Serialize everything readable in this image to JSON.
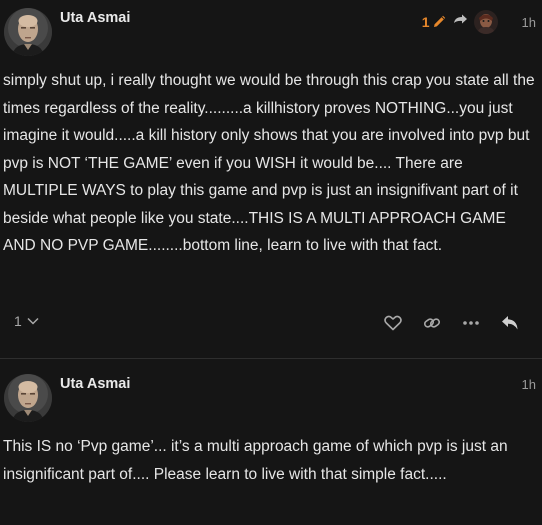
{
  "posts": [
    {
      "username": "Uta Asmai",
      "edit_count": "1",
      "time": "1h",
      "body": "simply shut up, i really thought we would be through this crap you state all the times regardless of the reality.........a killhistory proves NOTHING...you just imagine it would.....a kill history only shows that you are involved into pvp but pvp is NOT ‘THE GAME’ even if you WISH it would be.... There are MULTIPLE WAYS to play this game and pvp is just an insignifivant part of it beside what people like you state....THIS IS A MULTI APPROACH GAME AND NO PVP GAME........bottom line, learn to live with that fact.",
      "like_count": "1"
    },
    {
      "username": "Uta Asmai",
      "time": "1h",
      "body": "This IS no ‘Pvp game’... it’s a multi approach game of which pvp is just an insignificant part of.... Please learn to live with that simple fact....."
    }
  ],
  "colors": {
    "background": "#151515",
    "text": "#e6e6e6",
    "muted": "#9a9a9a",
    "edit_accent": "#e6872b",
    "divider": "#2e2e2e"
  },
  "icons": {
    "edit": "pencil-icon",
    "reply_to": "reply-arrow-icon",
    "expand": "chevron-down-icon",
    "like": "heart-icon",
    "copy_link": "link-icon",
    "more": "ellipsis-icon",
    "reply": "reply-icon"
  }
}
